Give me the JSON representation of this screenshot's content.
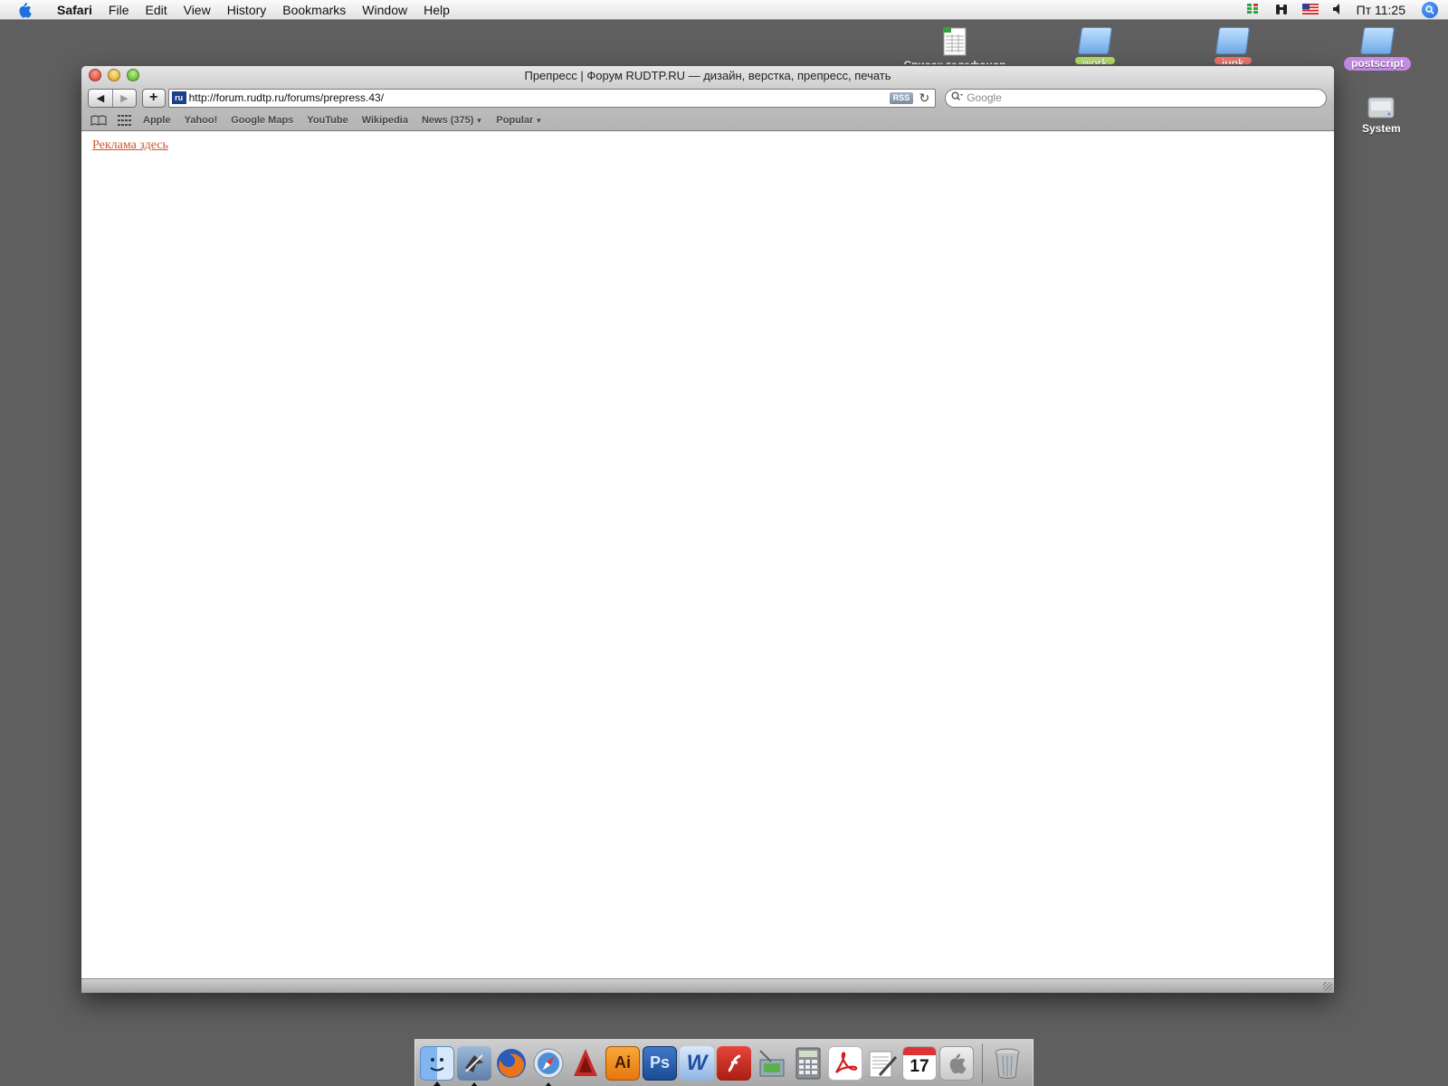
{
  "menubar": {
    "app_name": "Safari",
    "items": [
      "File",
      "Edit",
      "View",
      "History",
      "Bookmarks",
      "Window",
      "Help"
    ],
    "clock": "Пт 11:25",
    "status_icons": [
      "wifi-signal-icon",
      "binoculars-icon",
      "us-flag-input-icon",
      "volume-icon",
      "spotlight-icon"
    ]
  },
  "desktop": {
    "icons": [
      {
        "label": "Список телефонов",
        "icon": "spreadsheet-file-icon",
        "label_color": ""
      },
      {
        "label": "work",
        "icon": "folder-icon",
        "label_color": "#b6e06a"
      },
      {
        "label": "junk",
        "icon": "folder-icon",
        "label_color": "#f0776c"
      },
      {
        "label": "postscript",
        "icon": "folder-icon",
        "label_color": "#c48ae6"
      },
      {
        "label": "System",
        "icon": "hard-drive-icon",
        "label_color": ""
      }
    ]
  },
  "window": {
    "title": "Препресс | Форум RUDTP.RU — дизайн, верстка, препресс, печать",
    "url": "http://forum.rudtp.ru/forums/prepress.43/",
    "favicon_text": "ru",
    "rss_label": "RSS",
    "search_placeholder": "Google",
    "bookmarks": [
      "Apple",
      "Yahoo!",
      "Google Maps",
      "YouTube",
      "Wikipedia"
    ],
    "bookmark_menus": [
      "News (375)",
      "Popular"
    ],
    "content_link": "Реклама здесь",
    "link_color": "#d1532d"
  },
  "dock": {
    "apps": [
      {
        "name": "finder-icon",
        "running": true
      },
      {
        "name": "mail-icon",
        "running": true
      },
      {
        "name": "firefox-icon",
        "running": false
      },
      {
        "name": "safari-icon",
        "running": true
      },
      {
        "name": "acrobat-distiller-icon",
        "running": false
      },
      {
        "name": "illustrator-icon",
        "label": "Ai",
        "running": false
      },
      {
        "name": "photoshop-icon",
        "label": "Ps",
        "running": false
      },
      {
        "name": "word-icon",
        "label": "W",
        "running": false
      },
      {
        "name": "flash-icon",
        "running": false
      },
      {
        "name": "image-capture-icon",
        "running": false
      },
      {
        "name": "calculator-icon",
        "running": false
      },
      {
        "name": "acrobat-reader-icon",
        "running": false
      },
      {
        "name": "textedit-icon",
        "running": false
      },
      {
        "name": "ical-icon",
        "label": "17",
        "running": false
      },
      {
        "name": "preview-icon",
        "running": false
      },
      {
        "name": "trash-icon",
        "running": false
      }
    ]
  }
}
